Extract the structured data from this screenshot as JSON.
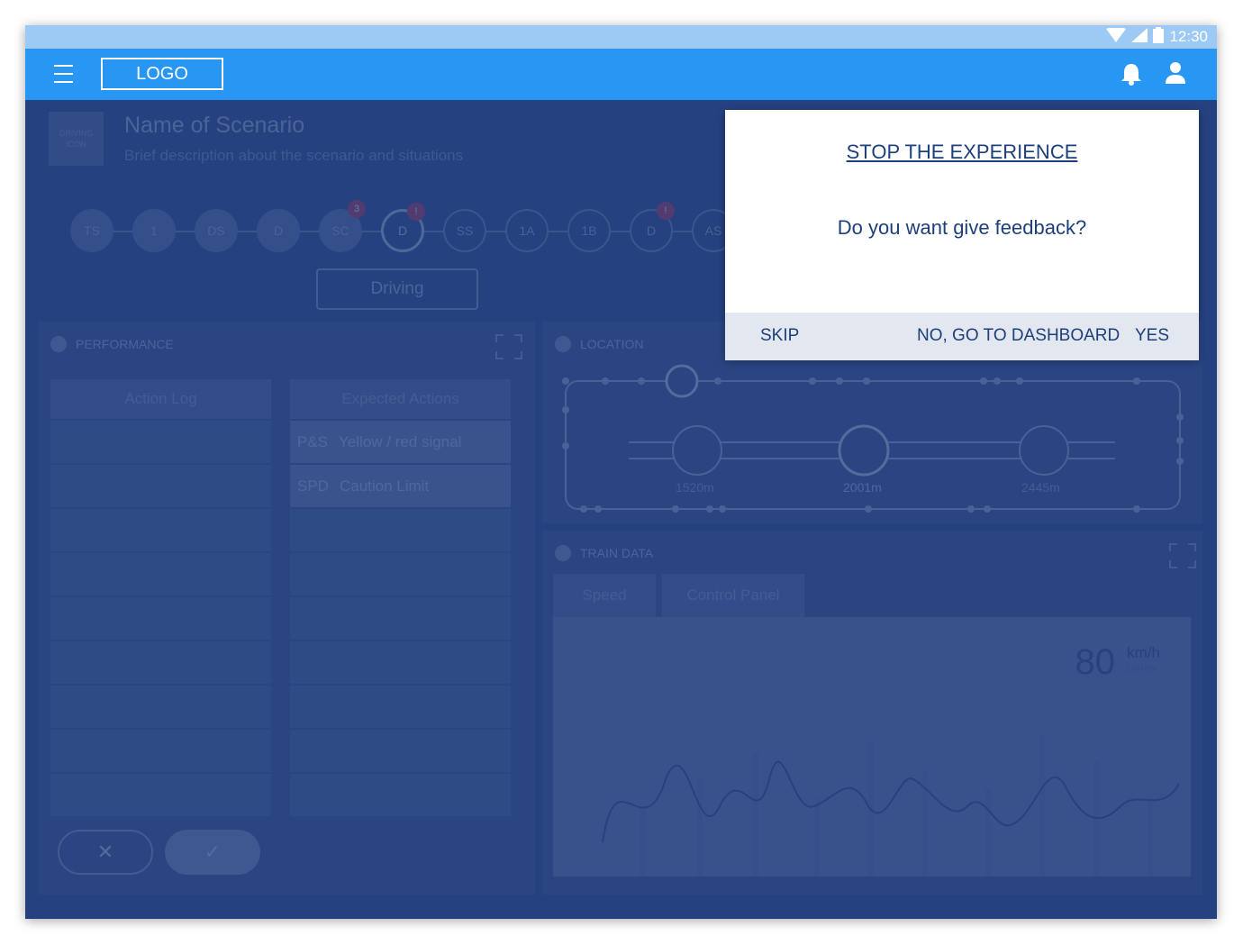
{
  "status_bar": {
    "time": "12:30",
    "icons": [
      "wifi-icon",
      "signal-icon",
      "battery-icon"
    ]
  },
  "app_bar": {
    "logo": "LOGO",
    "icons": [
      "menu-icon",
      "bell-icon",
      "user-icon"
    ]
  },
  "scenario": {
    "icon_label": "DRIVING ICON",
    "title": "Name of Scenario",
    "description": "Brief description about the scenario and situations"
  },
  "steps": [
    {
      "label": "TS"
    },
    {
      "label": "1"
    },
    {
      "label": "DS"
    },
    {
      "label": "D"
    },
    {
      "label": "SC",
      "badge": "3",
      "badge_color": "#c0395a"
    },
    {
      "label": "D",
      "current": true,
      "badge": "!",
      "badge_color": "#c0395a"
    },
    {
      "label": "SS"
    },
    {
      "label": "1A"
    },
    {
      "label": "1B"
    },
    {
      "label": "D",
      "badge": "!",
      "badge_color": "#c0395a"
    },
    {
      "label": "AS"
    }
  ],
  "current_step_label": "Driving",
  "performance": {
    "title": "PERFORMANCE",
    "action_log_header": "Action Log",
    "expected_header": "Expected Actions",
    "expected_rows": [
      {
        "code": "P&S",
        "text": "Yellow / red signal"
      },
      {
        "code": "SPD",
        "text": "Caution Limit"
      }
    ]
  },
  "location": {
    "title": "LOCATION",
    "markers": [
      {
        "distance": "1520m",
        "type": "cross-icon"
      },
      {
        "distance": "2001m",
        "type": "train-icon"
      },
      {
        "distance": "2445m",
        "type": "station-icon"
      }
    ]
  },
  "train_data": {
    "title": "TRAIN DATA",
    "tabs": [
      "Speed",
      "Control Panel"
    ],
    "speed_value": "80",
    "speed_unit": "km/h",
    "speed_caption": "Current"
  },
  "dialog": {
    "title": "STOP THE EXPERIENCE",
    "message": "Do you want give feedback?",
    "skip": "SKIP",
    "dashboard": "NO, GO TO DASHBOARD",
    "yes": "YES"
  },
  "colors": {
    "app_bar": "#2897f3",
    "status_bar": "#9ccaf5",
    "dim_bg": "#2b4a8c",
    "dialog_text": "#1d3f7c"
  }
}
